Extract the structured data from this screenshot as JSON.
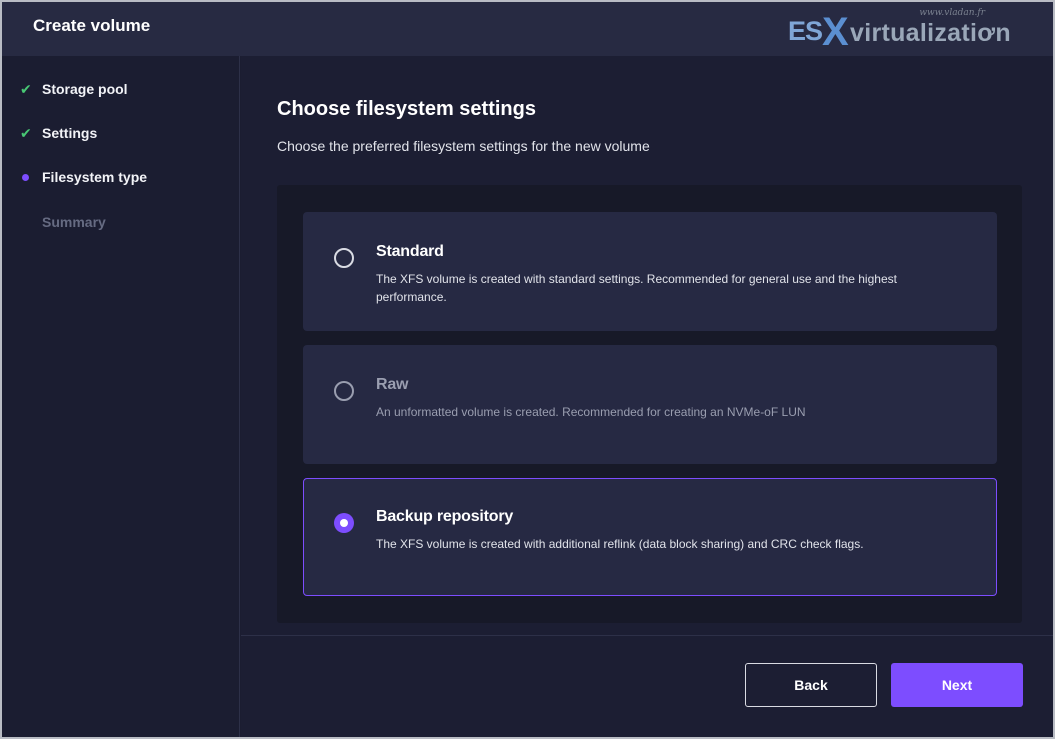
{
  "header": {
    "title": "Create volume"
  },
  "watermark": {
    "url": "www.vladan.fr",
    "es": "ES",
    "x": "X",
    "rest": "virtualizatiơn"
  },
  "sidebar": {
    "steps": [
      {
        "label": "Storage pool",
        "state": "done"
      },
      {
        "label": "Settings",
        "state": "done"
      },
      {
        "label": "Filesystem type",
        "state": "active"
      },
      {
        "label": "Summary",
        "state": "pending"
      }
    ]
  },
  "main": {
    "title": "Choose filesystem settings",
    "subtitle": "Choose the preferred filesystem settings for the new volume",
    "options": [
      {
        "title": "Standard",
        "description": "The XFS volume is created with standard settings. Recommended for general use and the highest performance.",
        "selected": false,
        "disabled": false
      },
      {
        "title": "Raw",
        "description": "An unformatted volume is created. Recommended for creating an NVMe-oF LUN",
        "selected": false,
        "disabled": true
      },
      {
        "title": "Backup repository",
        "description": "The XFS volume is created with additional reflink (data block sharing) and CRC check flags.",
        "selected": true,
        "disabled": false
      }
    ]
  },
  "footer": {
    "back_label": "Back",
    "next_label": "Next"
  },
  "colors": {
    "accent": "#7d4dff",
    "check": "#48c774",
    "background": "#1c1e33",
    "card": "#262943"
  },
  "icons": {
    "done": "check-icon",
    "active": "dot-icon"
  }
}
